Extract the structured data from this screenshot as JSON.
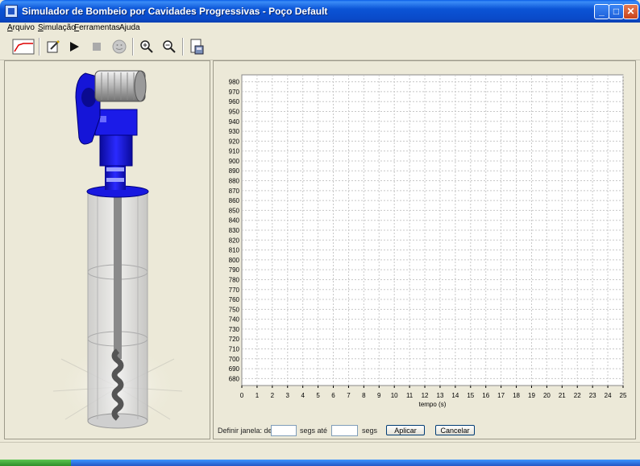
{
  "window": {
    "title": "Simulador de Bombeio por Cavidades Progressivas - Poço Default"
  },
  "window_controls": {
    "minimize": "_",
    "maximize": "□",
    "close": "✕"
  },
  "menu": {
    "items": [
      {
        "label": "Arquivo",
        "key": "A"
      },
      {
        "label": "Simulação",
        "key": "S"
      },
      {
        "label": "Ferramentas",
        "key": "F"
      },
      {
        "label": "Ajuda",
        "key": "j"
      }
    ]
  },
  "toolbar": {
    "icons": [
      "chart-icon",
      "edit-icon",
      "play-icon",
      "stop-icon",
      "status-face-icon",
      "zoom-in-icon",
      "zoom-out-icon",
      "export-icon"
    ]
  },
  "chart_data": {
    "type": "line",
    "xlabel": "tempo (s)",
    "xlim": [
      0,
      25
    ],
    "x_ticks": [
      0,
      1,
      2,
      3,
      4,
      5,
      6,
      7,
      8,
      9,
      10,
      11,
      12,
      13,
      14,
      15,
      16,
      17,
      18,
      19,
      20,
      21,
      22,
      23,
      24,
      25
    ],
    "ylim": [
      673,
      987
    ],
    "y_ticks": [
      680,
      690,
      700,
      710,
      720,
      730,
      740,
      750,
      760,
      770,
      780,
      790,
      800,
      810,
      820,
      830,
      840,
      850,
      860,
      870,
      880,
      890,
      900,
      910,
      920,
      930,
      940,
      950,
      960,
      970,
      980
    ],
    "grid": true,
    "series": []
  },
  "window_controls_form": {
    "label_prefix": "Definir janela: de",
    "from_value": "",
    "label_middle": "segs até",
    "to_value": "",
    "label_suffix": "segs",
    "apply_label": "Aplicar",
    "cancel_label": "Cancelar"
  },
  "colors": {
    "title_bar": "#0a54d6",
    "pump_blue": "#1a1ae6",
    "motor_gray": "#b8b8b8",
    "chart_bg": "#ffffff",
    "grid": "#c8c8c8"
  }
}
